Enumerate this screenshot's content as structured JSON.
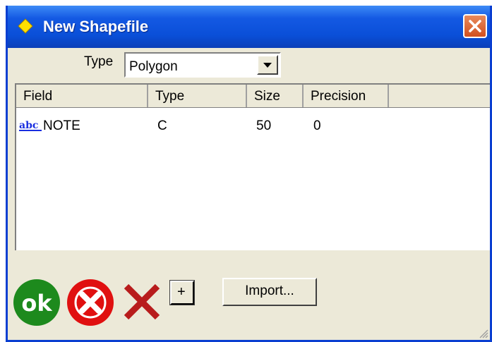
{
  "window": {
    "title": "New Shapefile",
    "title_icon": "yellow-diamond-icon",
    "close_icon": "close-icon"
  },
  "type_selector": {
    "label": "Type",
    "value": "Polygon",
    "dropdown_icon": "chevron-down-icon"
  },
  "fields_table": {
    "columns": [
      "Field",
      "Type",
      "Size",
      "Precision"
    ],
    "rows": [
      {
        "icon": "abc-text-field-icon",
        "field": "NOTE",
        "type": "C",
        "size": "50",
        "precision": "0"
      }
    ]
  },
  "toolbar": {
    "ok_icon": "ok-icon",
    "cancel_icon": "cancel-icon",
    "delete_icon": "delete-x-icon",
    "add_label": "+",
    "import_label": "Import..."
  },
  "colors": {
    "titlebar": "#0a4fd8",
    "window_bg": "#ece9d8",
    "ok_green": "#1d8a1d",
    "cancel_red": "#e01010",
    "delete_red": "#b81c1c"
  }
}
